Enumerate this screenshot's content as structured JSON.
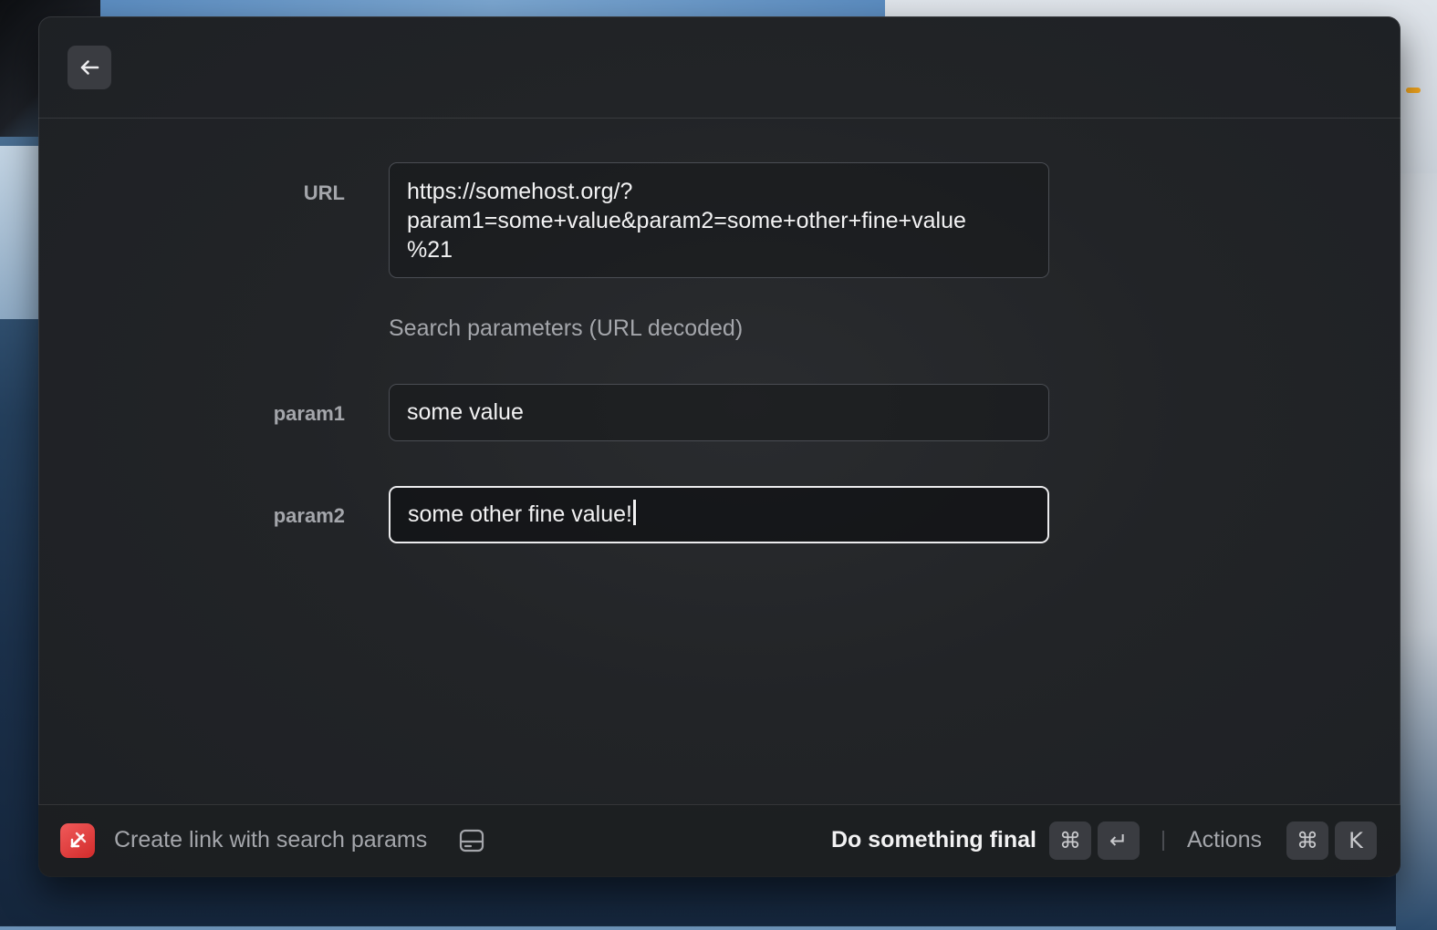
{
  "window": {
    "back_icon": "arrow-left-icon"
  },
  "form": {
    "url": {
      "label": "URL",
      "lines": [
        "https://somehost.org/?",
        "param1=some+value&param2=some+other+fine+value",
        "%21"
      ]
    },
    "section_heading": "Search parameters (URL decoded)",
    "params": [
      {
        "label": "param1",
        "value": "some value"
      },
      {
        "label": "param2",
        "value": "some other fine value!",
        "focused": true
      }
    ]
  },
  "action_bar": {
    "app_icon": "raycast-logo-icon",
    "title": "Create link with search params",
    "title_icon": "hard-drive-icon",
    "primary_action": "Do something final",
    "primary_shortcut": [
      "⌘",
      "↵"
    ],
    "actions_label": "Actions",
    "actions_shortcut": [
      "⌘",
      "K"
    ]
  },
  "colors": {
    "window_bg": "#222427",
    "text_primary": "#f2f2f3",
    "text_secondary": "#a4a6ab",
    "kbd_bg": "#3a3c41",
    "app_icon_red": "#e53c3c"
  }
}
